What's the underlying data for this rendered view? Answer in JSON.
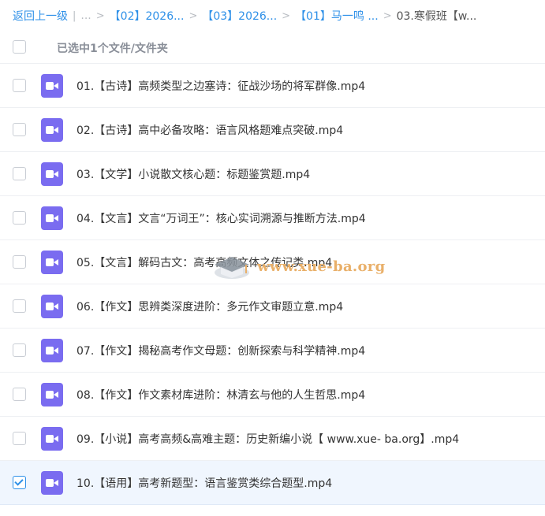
{
  "breadcrumb": {
    "back": "返回上一级",
    "items": [
      "...",
      "【02】2026...",
      "【03】2026...",
      "【01】马一鸣 ..."
    ],
    "current": "03.寒假班【w..."
  },
  "header": {
    "selected_text": "已选中1个文件/文件夹"
  },
  "files": [
    {
      "name": "01.【古诗】高频类型之边塞诗：征战沙场的将军群像.mp4",
      "checked": false,
      "icon": "video-file-icon"
    },
    {
      "name": "02.【古诗】高中必备攻略：语言风格题难点突破.mp4",
      "checked": false,
      "icon": "video-file-icon"
    },
    {
      "name": "03.【文学】小说散文核心题：标题鉴赏题.mp4",
      "checked": false,
      "icon": "video-file-icon"
    },
    {
      "name": "04.【文言】文言“万词王”：核心实词溯源与推断方法.mp4",
      "checked": false,
      "icon": "video-file-icon"
    },
    {
      "name": "05.【文言】解码古文：高考高频文体之传记类.mp4",
      "checked": false,
      "icon": "video-file-icon"
    },
    {
      "name": "06.【作文】思辨类深度进阶：多元作文审题立意.mp4",
      "checked": false,
      "icon": "video-file-icon"
    },
    {
      "name": "07.【作文】揭秘高考作文母题：创新探索与科学精神.mp4",
      "checked": false,
      "icon": "video-file-icon"
    },
    {
      "name": "08.【作文】作文素材库进阶：林清玄与他的人生哲思.mp4",
      "checked": false,
      "icon": "video-file-icon"
    },
    {
      "name": "09.【小说】高考高频&高难主题：历史新编小说【 www.xue- ba.org】.mp4",
      "checked": false,
      "icon": "video-file-icon"
    },
    {
      "name": "10.【语用】高考新题型：语言鉴赏类综合题型.mp4",
      "checked": true,
      "icon": "video-file-icon"
    }
  ],
  "watermark": {
    "text": "www.xue-ba.org"
  },
  "colors": {
    "link": "#2e90e8",
    "video_icon": "#7a6cf0",
    "selected_row": "#f0f6fe",
    "watermark": "#e9b06a"
  }
}
